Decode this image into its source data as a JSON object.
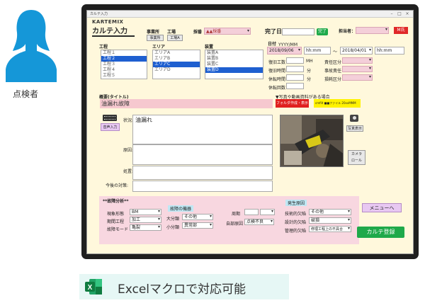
{
  "persona": {
    "label": "点検者",
    "icon": "user-icon"
  },
  "window": {
    "title": "カルテ入力"
  },
  "logo": {
    "brand": "KARTEMIX",
    "screen_name": "カルテ入力"
  },
  "header": {
    "office_label": "事業所",
    "office_value": "事業所",
    "factory_label": "工場",
    "factory_value": "工場A",
    "writer_label": "採番",
    "writer_value": "▲▲採番",
    "done_date_label": "完了日",
    "done_button": "完了",
    "inspector_label": "担当者：",
    "mail_button": "M氏"
  },
  "lists": {
    "process_label": "工程",
    "process_items": [
      "工程１",
      "工程２",
      "工程３",
      "工程４",
      "工程５"
    ],
    "process_selected": 1,
    "area_label": "エリア",
    "area_items": [
      "エリアA",
      "エリアB",
      "エリアC",
      "エリアD"
    ],
    "area_selected": 2,
    "device_label": "装置",
    "device_items": [
      "装置A",
      "装置B",
      "装置C",
      "装置D"
    ],
    "device_selected": 3
  },
  "date": {
    "label": "日付",
    "format_hint": "YYYY/MM",
    "start_value": "2018/09/06",
    "time_placeholder": "hh:mm",
    "tilde": "〜",
    "end_value": "2018/04/01",
    "end_time_placeholder": "hh:mm"
  },
  "work": {
    "repair_time_label": "復旧工数",
    "repair_unit": "MH",
    "recovery_time_label": "復旧時間",
    "recovery_unit": "分",
    "stop_time_label": "休転時間",
    "stop_unit": "分",
    "stop_count_label": "休転回数",
    "responsibility_label": "責任区分",
    "accident_label": "事故責任",
    "damage_label": "損耗区分"
  },
  "summary": {
    "title_label": "概要(タイトル)",
    "title_value": "油漏れ故障",
    "notice": "▼写真や動画資料がある場合",
    "folder_button": "フォルダ作成・表示",
    "yellow_note": "cmfilt ■■ファイル 20xxMMM",
    "voice_button": "音声入力",
    "status_label": "状況:",
    "status_value": "油漏れ",
    "cause_label": "原因:",
    "measure_label": "処置:",
    "future_label": "今後の対策:",
    "photo_button": "写真表示",
    "camera_button": "カメラ\nロール"
  },
  "analysis": {
    "title": "**故障分析**",
    "phenomenon_label": "現象形態",
    "phenomenon_value": "BM",
    "period_label": "期間工程",
    "period_value": "加工",
    "fault_mode_label": "故障モード",
    "fault_mode_value": "亀裂",
    "equipment_label": "故障の機器",
    "major_label": "大分類",
    "major_value": "その他",
    "minor_label": "小分類",
    "minor_value": "異常部",
    "cycle_label": "周期",
    "self_cause_label": "自部原因",
    "self_cause_value": "点検不良",
    "origin_label": "発生原因",
    "tech_label": "技術的欠陥",
    "tech_value": "その他",
    "design_label": "設計的欠陥",
    "design_value": "破損",
    "mgmt_label": "管理的欠陥",
    "mgmt_value": "修理工程上の不具合",
    "menu_button": "メニューへ",
    "register_button": "カルテ登録"
  },
  "footer": {
    "icon": "excel-icon",
    "text": "Excelマクロで対応可能"
  }
}
